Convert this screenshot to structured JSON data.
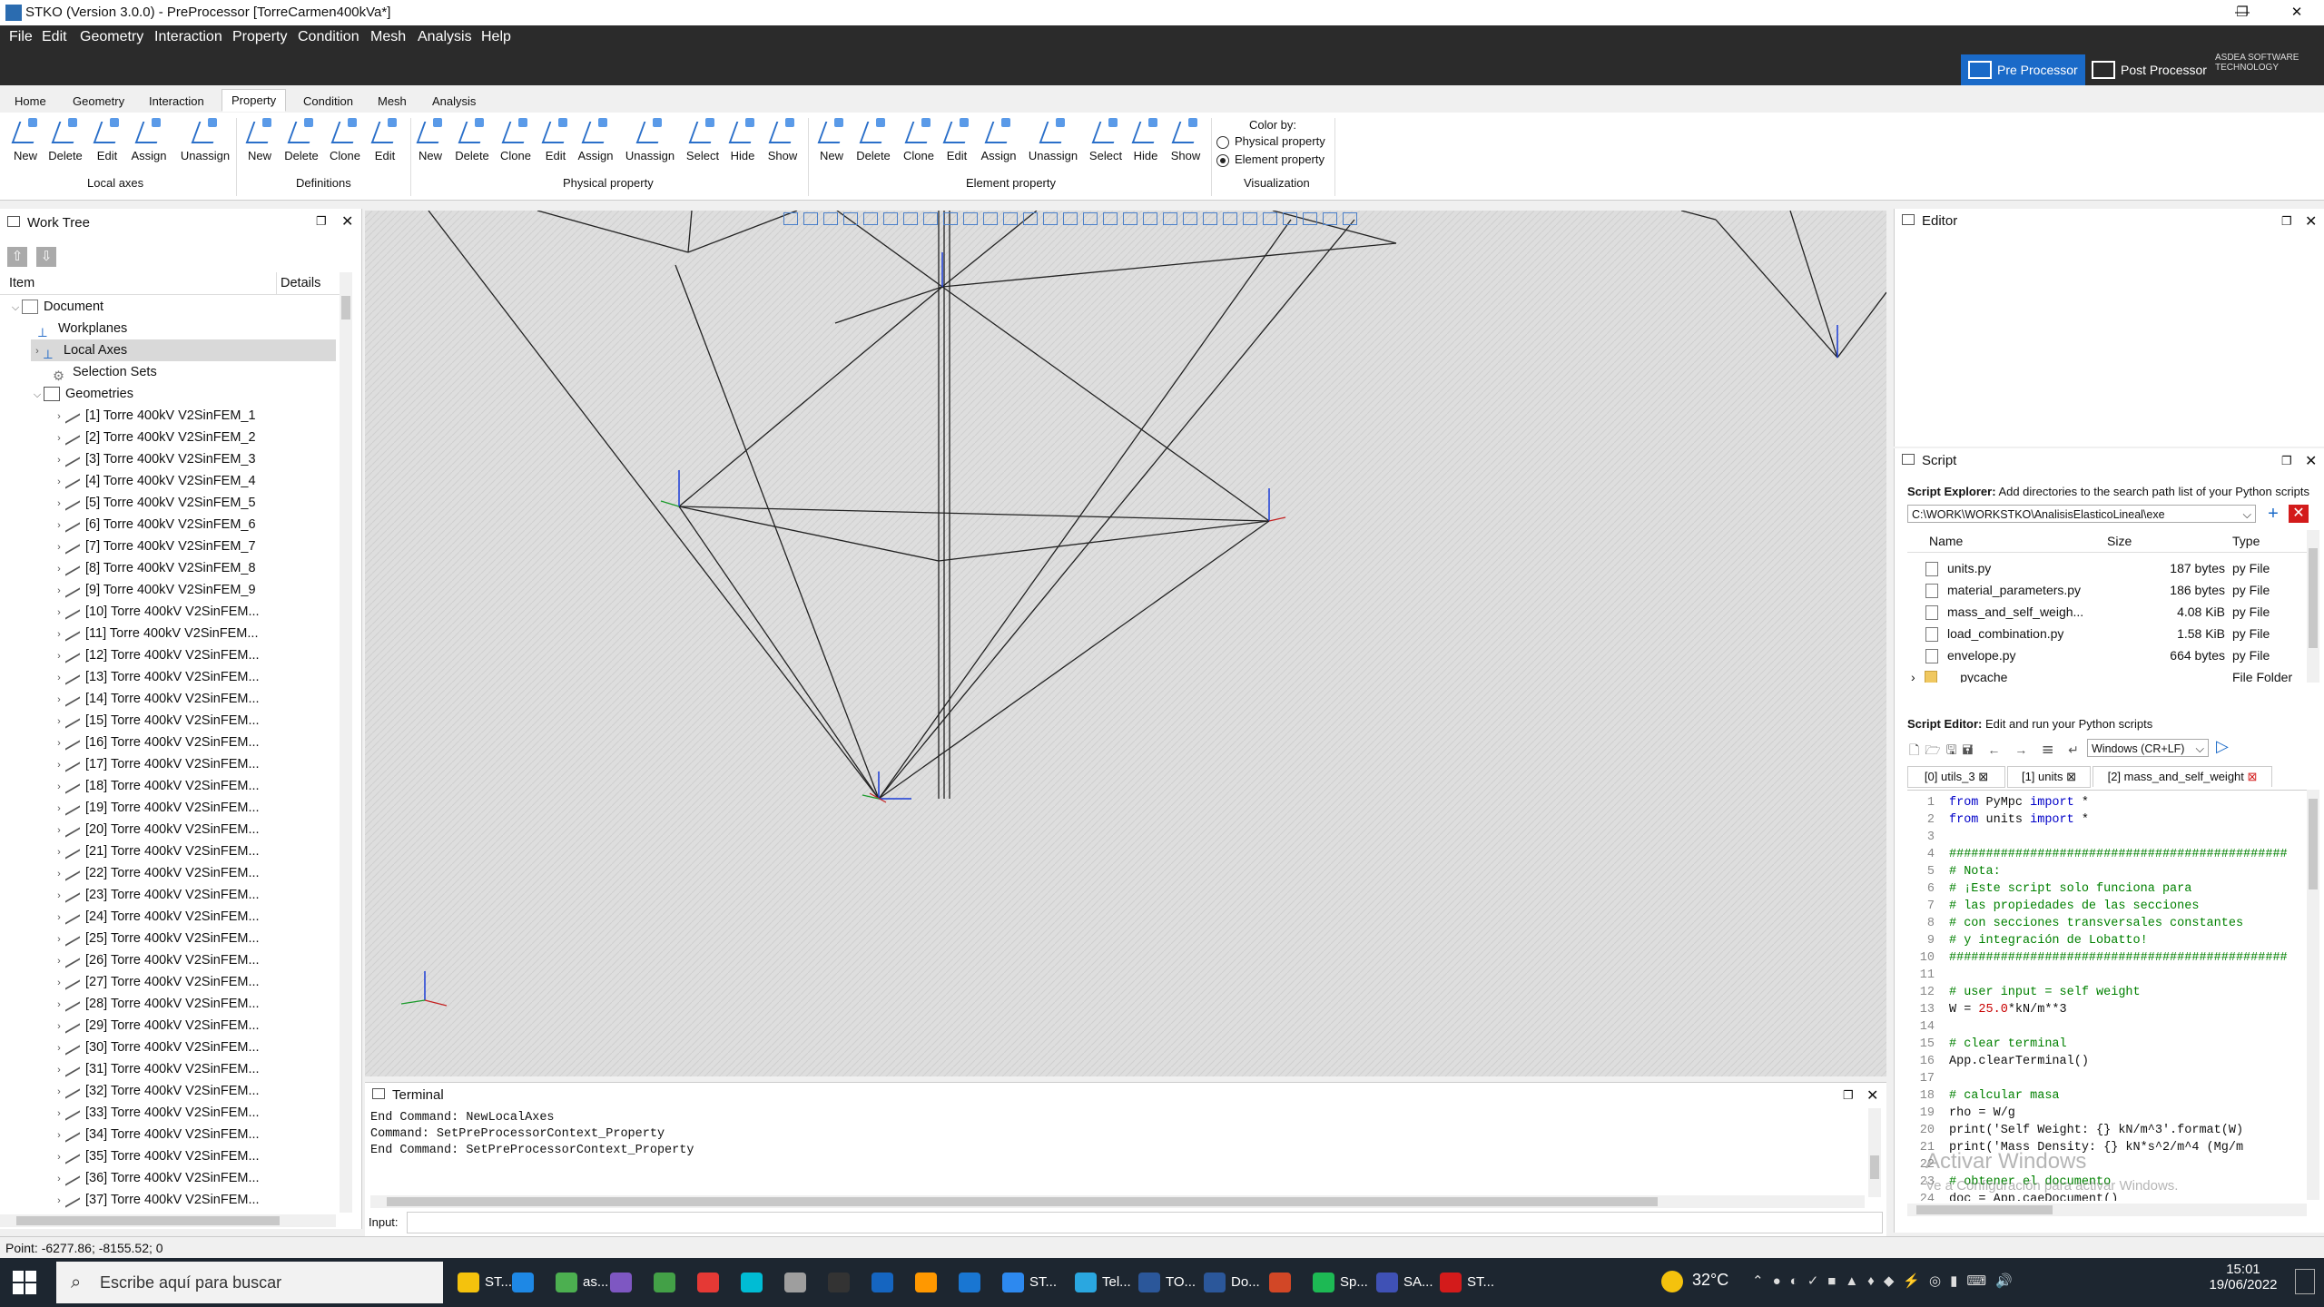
{
  "window": {
    "title": "STKO (Version 3.0.0) - PreProcessor [TorreCarmen400kVa*]",
    "controls": [
      "—",
      "❐",
      "✕"
    ]
  },
  "menu": [
    "File",
    "Edit",
    "Geometry",
    "Interaction",
    "Property",
    "Condition",
    "Mesh",
    "Analysis",
    "Help"
  ],
  "modes": {
    "pre": "Pre Processor",
    "post": "Post Processor",
    "logo": "ASDEA SOFTWARE TECHNOLOGY"
  },
  "ribbon_tabs": [
    "Home",
    "Geometry",
    "Interaction",
    "Property",
    "Condition",
    "Mesh",
    "Analysis"
  ],
  "ribbon": {
    "local_axes": {
      "buttons": [
        "New",
        "Delete",
        "Edit",
        "Assign",
        "Unassign"
      ],
      "label": "Local axes"
    },
    "definitions": {
      "buttons": [
        "New",
        "Delete",
        "Clone",
        "Edit"
      ],
      "label": "Definitions"
    },
    "physical": {
      "buttons": [
        "New",
        "Delete",
        "Clone",
        "Edit",
        "Assign",
        "Unassign",
        "Select",
        "Hide",
        "Show"
      ],
      "label": "Physical property"
    },
    "element": {
      "buttons": [
        "New",
        "Delete",
        "Clone",
        "Edit",
        "Assign",
        "Unassign",
        "Select",
        "Hide",
        "Show"
      ],
      "label": "Element property"
    },
    "visualization": {
      "color_by": "Color by:",
      "opt1": "Physical property",
      "opt2": "Element property",
      "label": "Visualization"
    }
  },
  "worktree": {
    "title": "Work Tree",
    "col_item": "Item",
    "col_details": "Details",
    "top_items": [
      "Document",
      "Workplanes",
      "Local Axes",
      "Selection Sets",
      "Geometries"
    ],
    "geometries": [
      "[1] Torre 400kV V2SinFEM_1",
      "[2] Torre 400kV V2SinFEM_2",
      "[3] Torre 400kV V2SinFEM_3",
      "[4] Torre 400kV V2SinFEM_4",
      "[5] Torre 400kV V2SinFEM_5",
      "[6] Torre 400kV V2SinFEM_6",
      "[7] Torre 400kV V2SinFEM_7",
      "[8] Torre 400kV V2SinFEM_8",
      "[9] Torre 400kV V2SinFEM_9",
      "[10] Torre 400kV V2SinFEM...",
      "[11] Torre 400kV V2SinFEM...",
      "[12] Torre 400kV V2SinFEM...",
      "[13] Torre 400kV V2SinFEM...",
      "[14] Torre 400kV V2SinFEM...",
      "[15] Torre 400kV V2SinFEM...",
      "[16] Torre 400kV V2SinFEM...",
      "[17] Torre 400kV V2SinFEM...",
      "[18] Torre 400kV V2SinFEM...",
      "[19] Torre 400kV V2SinFEM...",
      "[20] Torre 400kV V2SinFEM...",
      "[21] Torre 400kV V2SinFEM...",
      "[22] Torre 400kV V2SinFEM...",
      "[23] Torre 400kV V2SinFEM...",
      "[24] Torre 400kV V2SinFEM...",
      "[25] Torre 400kV V2SinFEM...",
      "[26] Torre 400kV V2SinFEM...",
      "[27] Torre 400kV V2SinFEM...",
      "[28] Torre 400kV V2SinFEM...",
      "[29] Torre 400kV V2SinFEM...",
      "[30] Torre 400kV V2SinFEM...",
      "[31] Torre 400kV V2SinFEM...",
      "[32] Torre 400kV V2SinFEM...",
      "[33] Torre 400kV V2SinFEM...",
      "[34] Torre 400kV V2SinFEM...",
      "[35] Torre 400kV V2SinFEM...",
      "[36] Torre 400kV V2SinFEM...",
      "[37] Torre 400kV V2SinFEM..."
    ]
  },
  "terminal": {
    "title": "Terminal",
    "lines": [
      "End Command: NewLocalAxes",
      "Command: SetPreProcessorContext_Property",
      "End Command: SetPreProcessorContext_Property"
    ],
    "input_label": "Input:"
  },
  "editor": {
    "title": "Editor"
  },
  "script": {
    "title": "Script",
    "explorer_label": "Script Explorer:",
    "explorer_desc": "Add directories to the search path list of your Python scripts",
    "path": "C:\\WORK\\WORKSTKO\\AnalisisElasticoLineal\\exe",
    "col_name": "Name",
    "col_size": "Size",
    "col_type": "Type",
    "files": [
      {
        "name": "units.py",
        "size": "187 bytes",
        "type": "py File"
      },
      {
        "name": "material_parameters.py",
        "size": "186 bytes",
        "type": "py File"
      },
      {
        "name": "mass_and_self_weigh...",
        "size": "4.08 KiB",
        "type": "py File"
      },
      {
        "name": "load_combination.py",
        "size": "1.58 KiB",
        "type": "py File"
      },
      {
        "name": "envelope.py",
        "size": "664 bytes",
        "type": "py File"
      },
      {
        "name": "__pycache__",
        "size": "",
        "type": "File Folder"
      }
    ],
    "editor_label": "Script Editor:",
    "editor_desc": "Edit and run your Python scripts",
    "line_ending": "Windows (CR+LF)",
    "tabs": [
      "[0] utils_3",
      "[1] units",
      "[2] mass_and_self_weight"
    ],
    "code": [
      "from PyMpc import *",
      "from units import *",
      "",
      "##############################################",
      "# Nota:",
      "# ¡Este script solo funciona para",
      "# las propiedades de las secciones",
      "# con secciones transversales constantes",
      "# y integración de Lobatto!",
      "##############################################",
      "",
      "# user input = self weight",
      "W = 25.0*kN/m**3",
      "",
      "# clear terminal",
      "App.clearTerminal()",
      "",
      "# calcular masa",
      "rho = W/g",
      "print('Self Weight: {} kN/m^3'.format(W)",
      "print('Mass Density: {} kN*s^2/m^4 (Mg/m",
      "",
      "# obtener el documento",
      "doc = App.caeDocument()"
    ],
    "watermark1": "Activar Windows",
    "watermark2": "Ve a Configuración para activar Windows."
  },
  "status": {
    "point": "Point: -6277.86; -8155.52; 0"
  },
  "taskbar": {
    "search_placeholder": "Escribe aquí para buscar",
    "apps": [
      "ST...",
      "",
      "as...",
      "",
      "",
      "",
      "",
      "",
      "",
      "",
      "",
      "",
      "ST...",
      "Tel...",
      "TO...",
      "Do...",
      "",
      "Sp...",
      "SA...",
      "ST..."
    ],
    "temp": "32°C",
    "time": "15:01",
    "date": "19/06/2022"
  }
}
